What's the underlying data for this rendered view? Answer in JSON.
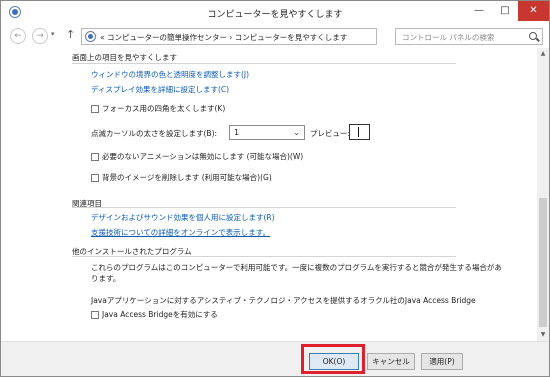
{
  "window": {
    "title": "コンピューターを見やすくします",
    "min_label": "—",
    "max_label": "□",
    "close_label": "✕"
  },
  "nav": {
    "back_glyph": "←",
    "forward_glyph": "→",
    "dropdown_glyph": "▾",
    "up_glyph": "↑",
    "address_text": "«  コンピューターの簡単操作センター  ›  コンピューターを見やすくします",
    "address_drop_glyph": "▾",
    "refresh_glyph": "↻",
    "search_placeholder": "コントロール パネルの検索"
  },
  "section1": {
    "heading": "画面上の項目を見やすくします",
    "link1": "ウィンドウの境界の色と透明度を調整します(J)",
    "link2": "ディスプレイ効果を詳細に設定します(C)",
    "check_thick_focus": "フォーカス用の四角を太くします(K)",
    "cursor_label": "点滅カーソルの太さを設定します(B):",
    "cursor_value": "1",
    "select_arrow": "⌄",
    "preview_label": "プレビュー:",
    "check_animation": "必要のないアニメーションは無効にします (可能な場合)(W)",
    "check_background": "背景のイメージを削除します (利用可能な場合)(G)"
  },
  "section2": {
    "heading": "関連項目",
    "link1": "デザインおよびサウンド効果を個人用に設定します(R)",
    "link2": "支援技術についての詳細をオンラインで表示します。"
  },
  "section3": {
    "heading": "他のインストールされたプログラム",
    "desc_line1": "これらのプログラムはこのコンピューターで利用可能です。一度に複数のプログラムを実行すると競合が発生する場合があ",
    "desc_line2": "ります。",
    "java_desc": "Javaアプリケーションに対するアシスティブ・テクノロジ・アクセスを提供するオラクル社のJava Access Bridge",
    "check_java": "Java Access Bridgeを有効にする"
  },
  "scrollbar": {
    "up_glyph": "▲",
    "down_glyph": "▼"
  },
  "footer": {
    "ok_label": "OK(O)",
    "cancel_label": "キャンセル",
    "apply_label": "適用(P)"
  },
  "colors": {
    "link": "#0b5ab8",
    "highlight": "#e0202c",
    "close_button": "#c7372f"
  }
}
